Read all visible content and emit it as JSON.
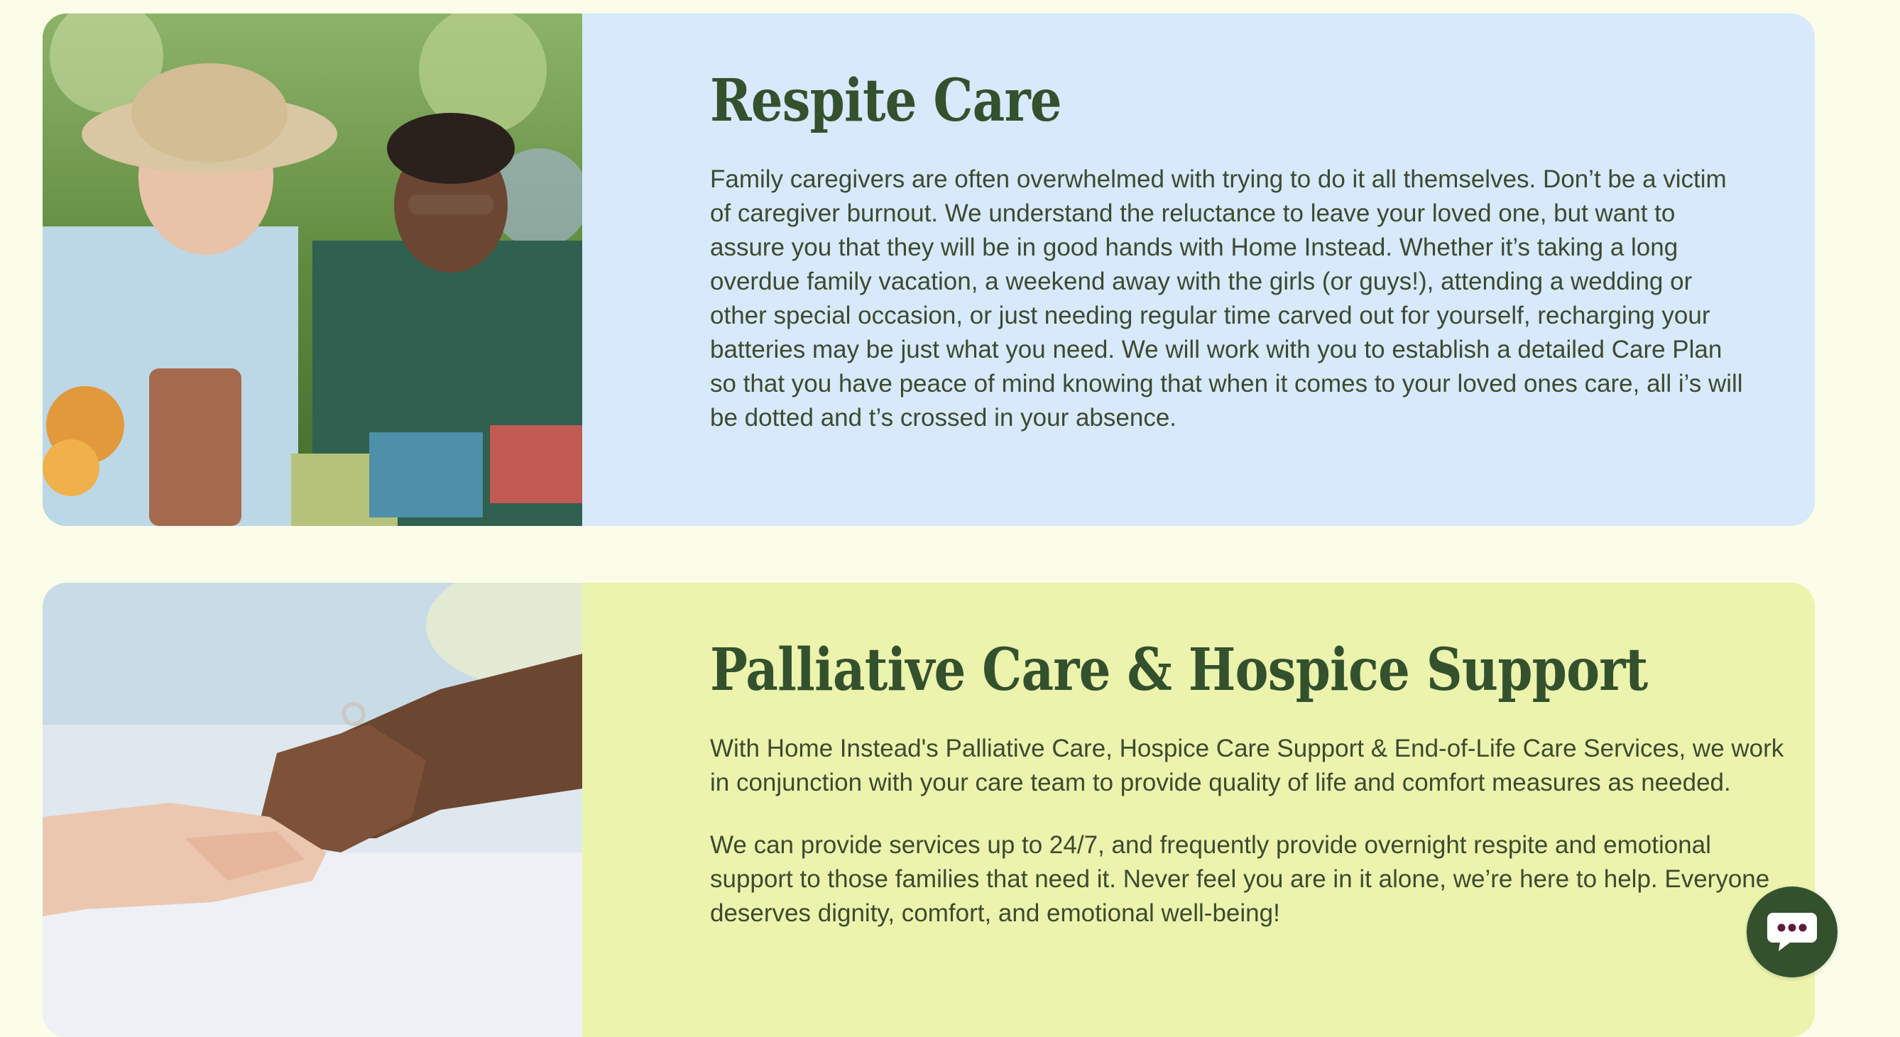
{
  "sections": [
    {
      "title": "Respite Care",
      "paragraphs": [
        "Family caregivers are often overwhelmed with trying to do it all themselves. Don’t be a victim of caregiver burnout. We understand the reluctance to leave your loved one, but want to assure you that they will be in good hands with Home Instead. Whether it’s taking a long overdue family vacation, a weekend away with the girls (or guys!), attending a wedding or other special occasion, or just needing regular time carved out for yourself, recharging your batteries may be just what you need. We will work with you to establish a detailed Care Plan so that you have peace of mind knowing that when it comes to your loved ones care, all i’s will be dotted and t’s crossed in your absence."
      ],
      "background": "#d7e9fb",
      "image_icon": "photo-seniors-gardening"
    },
    {
      "title": "Palliative Care & Hospice Support",
      "paragraphs": [
        "With Home Instead's Palliative Care, Hospice Care Support & End-of-Life Care Services, we work in conjunction with your care team to provide quality of life and comfort measures as needed.",
        "We can provide services up to 24/7, and frequently provide overnight respite and emotional support to those families that need it. Never feel you are in it alone, we’re here to help. Everyone deserves dignity, comfort, and emotional well-being!"
      ],
      "background": "#ecf3ad",
      "image_icon": "photo-holding-hands"
    }
  ],
  "chat_button": {
    "icon": "chat-bubble-icon",
    "color": "#33512d",
    "dots_color": "#5a1e3a"
  },
  "colors": {
    "page_background": "#fbfde9",
    "heading": "#34512e",
    "body_text": "#3d4a2f"
  }
}
